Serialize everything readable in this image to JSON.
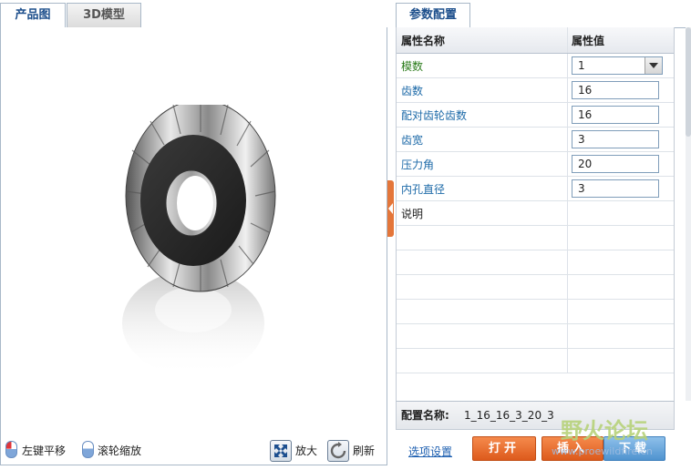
{
  "left_tabs": [
    {
      "label": "产品图",
      "active": true
    },
    {
      "label": "3D模型",
      "active": false
    }
  ],
  "controls": {
    "pan": "左键平移",
    "zoom_wheel": "滚轮缩放",
    "zoom_in": "放大",
    "refresh": "刷新"
  },
  "right_tab": "参数配置",
  "table": {
    "headers": [
      "属性名称",
      "属性值"
    ],
    "rows": [
      {
        "name": "模数",
        "value": "1",
        "type": "select"
      },
      {
        "name": "齿数",
        "value": "16",
        "type": "input"
      },
      {
        "name": "配对齿轮齿数",
        "value": "16",
        "type": "input"
      },
      {
        "name": "齿宽",
        "value": "3",
        "type": "input"
      },
      {
        "name": "压力角",
        "value": "20",
        "type": "input"
      },
      {
        "name": "内孔直径",
        "value": "3",
        "type": "input"
      },
      {
        "name": "说明",
        "value": "",
        "type": "text"
      }
    ]
  },
  "config": {
    "label": "配置名称:",
    "value": "1_16_16_3_20_3"
  },
  "footer": {
    "options_link": "选项设置",
    "open": "打开",
    "insert": "插入",
    "download": "下载"
  },
  "watermark": {
    "text": "野火论坛",
    "url": "www.proewildfire.cn"
  },
  "colors": {
    "accent_orange": "#e4763a",
    "link_blue": "#1d5fb0",
    "tab_active": "#1d4f8c"
  }
}
